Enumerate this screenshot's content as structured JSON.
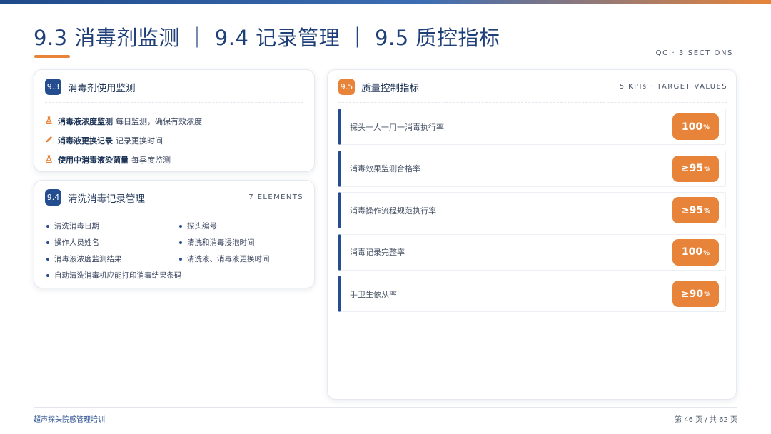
{
  "header": {
    "title": "9.3 消毒剂监测 ｜ 9.4 记录管理 ｜ 9.5 质控指标",
    "meta": "QC · 3 SECTIONS"
  },
  "monitoring": {
    "badge": "9.3",
    "title": "消毒剂使用监测",
    "items": [
      {
        "icon": "flask-icon",
        "strong": "消毒液浓度监测",
        "text": "每日监测，确保有效浓度"
      },
      {
        "icon": "pencil-icon",
        "strong": "消毒液更换记录",
        "text": "记录更换时间"
      },
      {
        "icon": "flask-icon",
        "strong": "使用中消毒液染菌量",
        "text": "每季度监测"
      }
    ]
  },
  "records": {
    "badge": "9.4",
    "title": "清洗消毒记录管理",
    "meta": "7 ELEMENTS",
    "items": [
      "清洗消毒日期",
      "探头编号",
      "操作人员姓名",
      "清洗和消毒浸泡时间",
      "消毒液浓度监测结果",
      "清洗液、消毒液更换时间",
      "自动清洗消毒机应能打印消毒结果条码"
    ]
  },
  "quality": {
    "badge": "9.5",
    "title": "质量控制指标",
    "meta": "5 KPIs · TARGET VALUES",
    "kpis": [
      {
        "label": "探头一人一用一消毒执行率",
        "value": "100",
        "unit": "%"
      },
      {
        "label": "消毒效果监测合格率",
        "value": "≥95",
        "unit": "%"
      },
      {
        "label": "消毒操作流程规范执行率",
        "value": "≥95",
        "unit": "%"
      },
      {
        "label": "消毒记录完整率",
        "value": "100",
        "unit": "%"
      },
      {
        "label": "手卫生依从率",
        "value": "≥90",
        "unit": "%"
      }
    ]
  },
  "footer": {
    "left": "超声探头院感管理培训",
    "page_prefix": "第",
    "page_current": "46",
    "page_mid": "页 / 共",
    "page_total": "62",
    "page_suffix": "页"
  },
  "colors": {
    "primary": "#234d8f",
    "accent": "#e8843a",
    "title": "#1f3f78"
  }
}
